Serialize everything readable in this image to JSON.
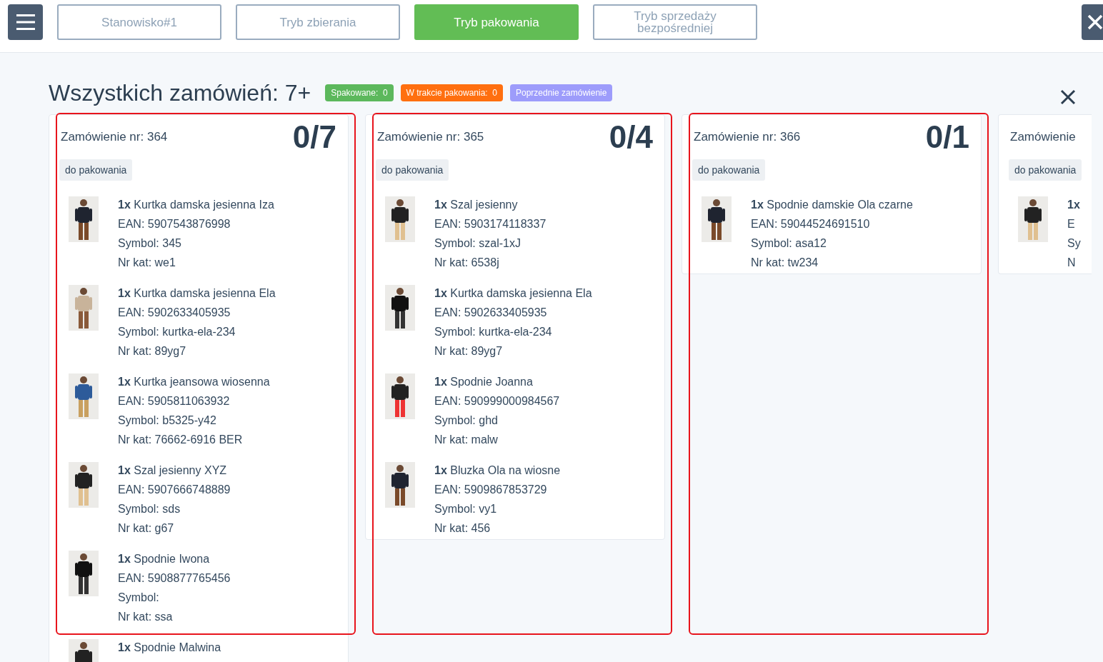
{
  "topbar": {
    "tabs": [
      {
        "label": "Stanowisko#1",
        "selected": false
      },
      {
        "label": "Tryb zbierania",
        "selected": false
      },
      {
        "label": "Tryb pakowania",
        "selected": true
      },
      {
        "label": "Tryb sprzedaży bezpośredniej",
        "selected": false
      }
    ]
  },
  "header": {
    "title": "Wszystkich zamówień: 7+",
    "badges": [
      {
        "label": "Spakowane:  0",
        "color": "#5cb85c"
      },
      {
        "label": "W trakcie pakowania:  0",
        "color": "#ff6f0f"
      },
      {
        "label": "Poprzednie zamówienie",
        "color": "#9d9cfb"
      }
    ]
  },
  "orders": [
    {
      "title": "Zamówienie nr: 364",
      "counter": "0/7",
      "status": "do pakowania",
      "highlighted": true,
      "items": [
        {
          "qty": "1x",
          "name": "Kurtka damska jesienna Iza",
          "lines": [
            "EAN: 5907543876998",
            "Symbol: 345",
            "Nr kat: we1"
          ]
        },
        {
          "qty": "1x",
          "name": "Kurtka damska jesienna Ela",
          "lines": [
            "EAN: 5902633405935",
            "Symbol: kurtka-ela-234",
            "Nr kat: 89yg7"
          ]
        },
        {
          "qty": "1x",
          "name": "Kurtka jeansowa wiosenna",
          "lines": [
            "EAN: 5905811063932",
            "Symbol: b5325-y42",
            "Nr kat: 76662-6916 BER"
          ]
        },
        {
          "qty": "1x",
          "name": "Szal jesienny XYZ",
          "lines": [
            "EAN: 5907666748889",
            "Symbol: sds",
            "Nr kat: g67"
          ]
        },
        {
          "qty": "1x",
          "name": "Spodnie Iwona",
          "lines": [
            "EAN: 5908877765456",
            "Symbol:",
            "Nr kat: ssa"
          ]
        },
        {
          "qty": "1x",
          "name": "Spodnie Malwina"
        }
      ]
    },
    {
      "title": "Zamówienie nr: 365",
      "counter": "0/4",
      "status": "do pakowania",
      "highlighted": true,
      "items": [
        {
          "qty": "1x",
          "name": "Szal jesienny",
          "lines": [
            "EAN: 5903174118337",
            "Symbol: szal-1xJ",
            "Nr kat: 6538j"
          ]
        },
        {
          "qty": "1x",
          "name": "Kurtka damska jesienna Ela",
          "lines": [
            "EAN: 5902633405935",
            "Symbol: kurtka-ela-234",
            "Nr kat: 89yg7"
          ]
        },
        {
          "qty": "1x",
          "name": "Spodnie Joanna",
          "lines": [
            "EAN: 590999000984567",
            "Symbol: ghd",
            "Nr kat: malw"
          ]
        },
        {
          "qty": "1x",
          "name": "Bluzka Ola na wiosne",
          "lines": [
            "EAN: 5909867853729",
            "Symbol: vy1",
            "Nr kat: 456"
          ]
        }
      ]
    },
    {
      "title": "Zamówienie nr: 366",
      "counter": "0/1",
      "status": "do pakowania",
      "highlighted": true,
      "items": [
        {
          "qty": "1x",
          "name": "Spodnie damskie Ola czarne",
          "lines": [
            "EAN: 59044524691510",
            "Symbol: asa12",
            "Nr kat: tw234"
          ]
        }
      ]
    },
    {
      "title": "Zamówienie",
      "status": "do pakowania",
      "highlighted": false,
      "items": [
        {
          "qty": "1x",
          "lines": [
            "E",
            "Sy",
            "N"
          ]
        }
      ]
    }
  ]
}
